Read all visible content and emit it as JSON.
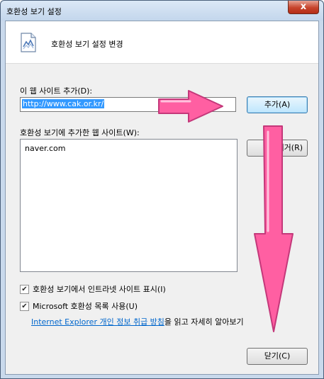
{
  "window": {
    "title": "호환성 보기 설정",
    "close_glyph": "x"
  },
  "header": {
    "title": "호환성 보기 설정 변경",
    "icon": "compatibility-page-icon"
  },
  "add_site": {
    "label": "이 웹 사이트 추가(D):",
    "value": "http://www.cak.or.kr/",
    "add_button": "추가(A)"
  },
  "site_list": {
    "label": "호환성 보기에 추가한 웹 사이트(W):",
    "items": [
      "naver.com"
    ],
    "remove_button_visible": "제거(R)"
  },
  "options": {
    "intranet": {
      "label": "호환성 보기에서 인트라넷 사이트 표시(I)",
      "checked": true
    },
    "ms_list": {
      "label": "Microsoft 호환성 목록 사용(U)",
      "checked": true
    }
  },
  "privacy": {
    "link_text": "Internet Explorer 개인 정보 취급 방침",
    "suffix_text": "을 읽고 자세히 알아보기"
  },
  "footer": {
    "close_button": "닫기(C)"
  },
  "colors": {
    "arrow_fill": "#ff5fa2",
    "arrow_stroke": "#c4387a",
    "selection": "#3399ff",
    "link": "#0066cc"
  }
}
